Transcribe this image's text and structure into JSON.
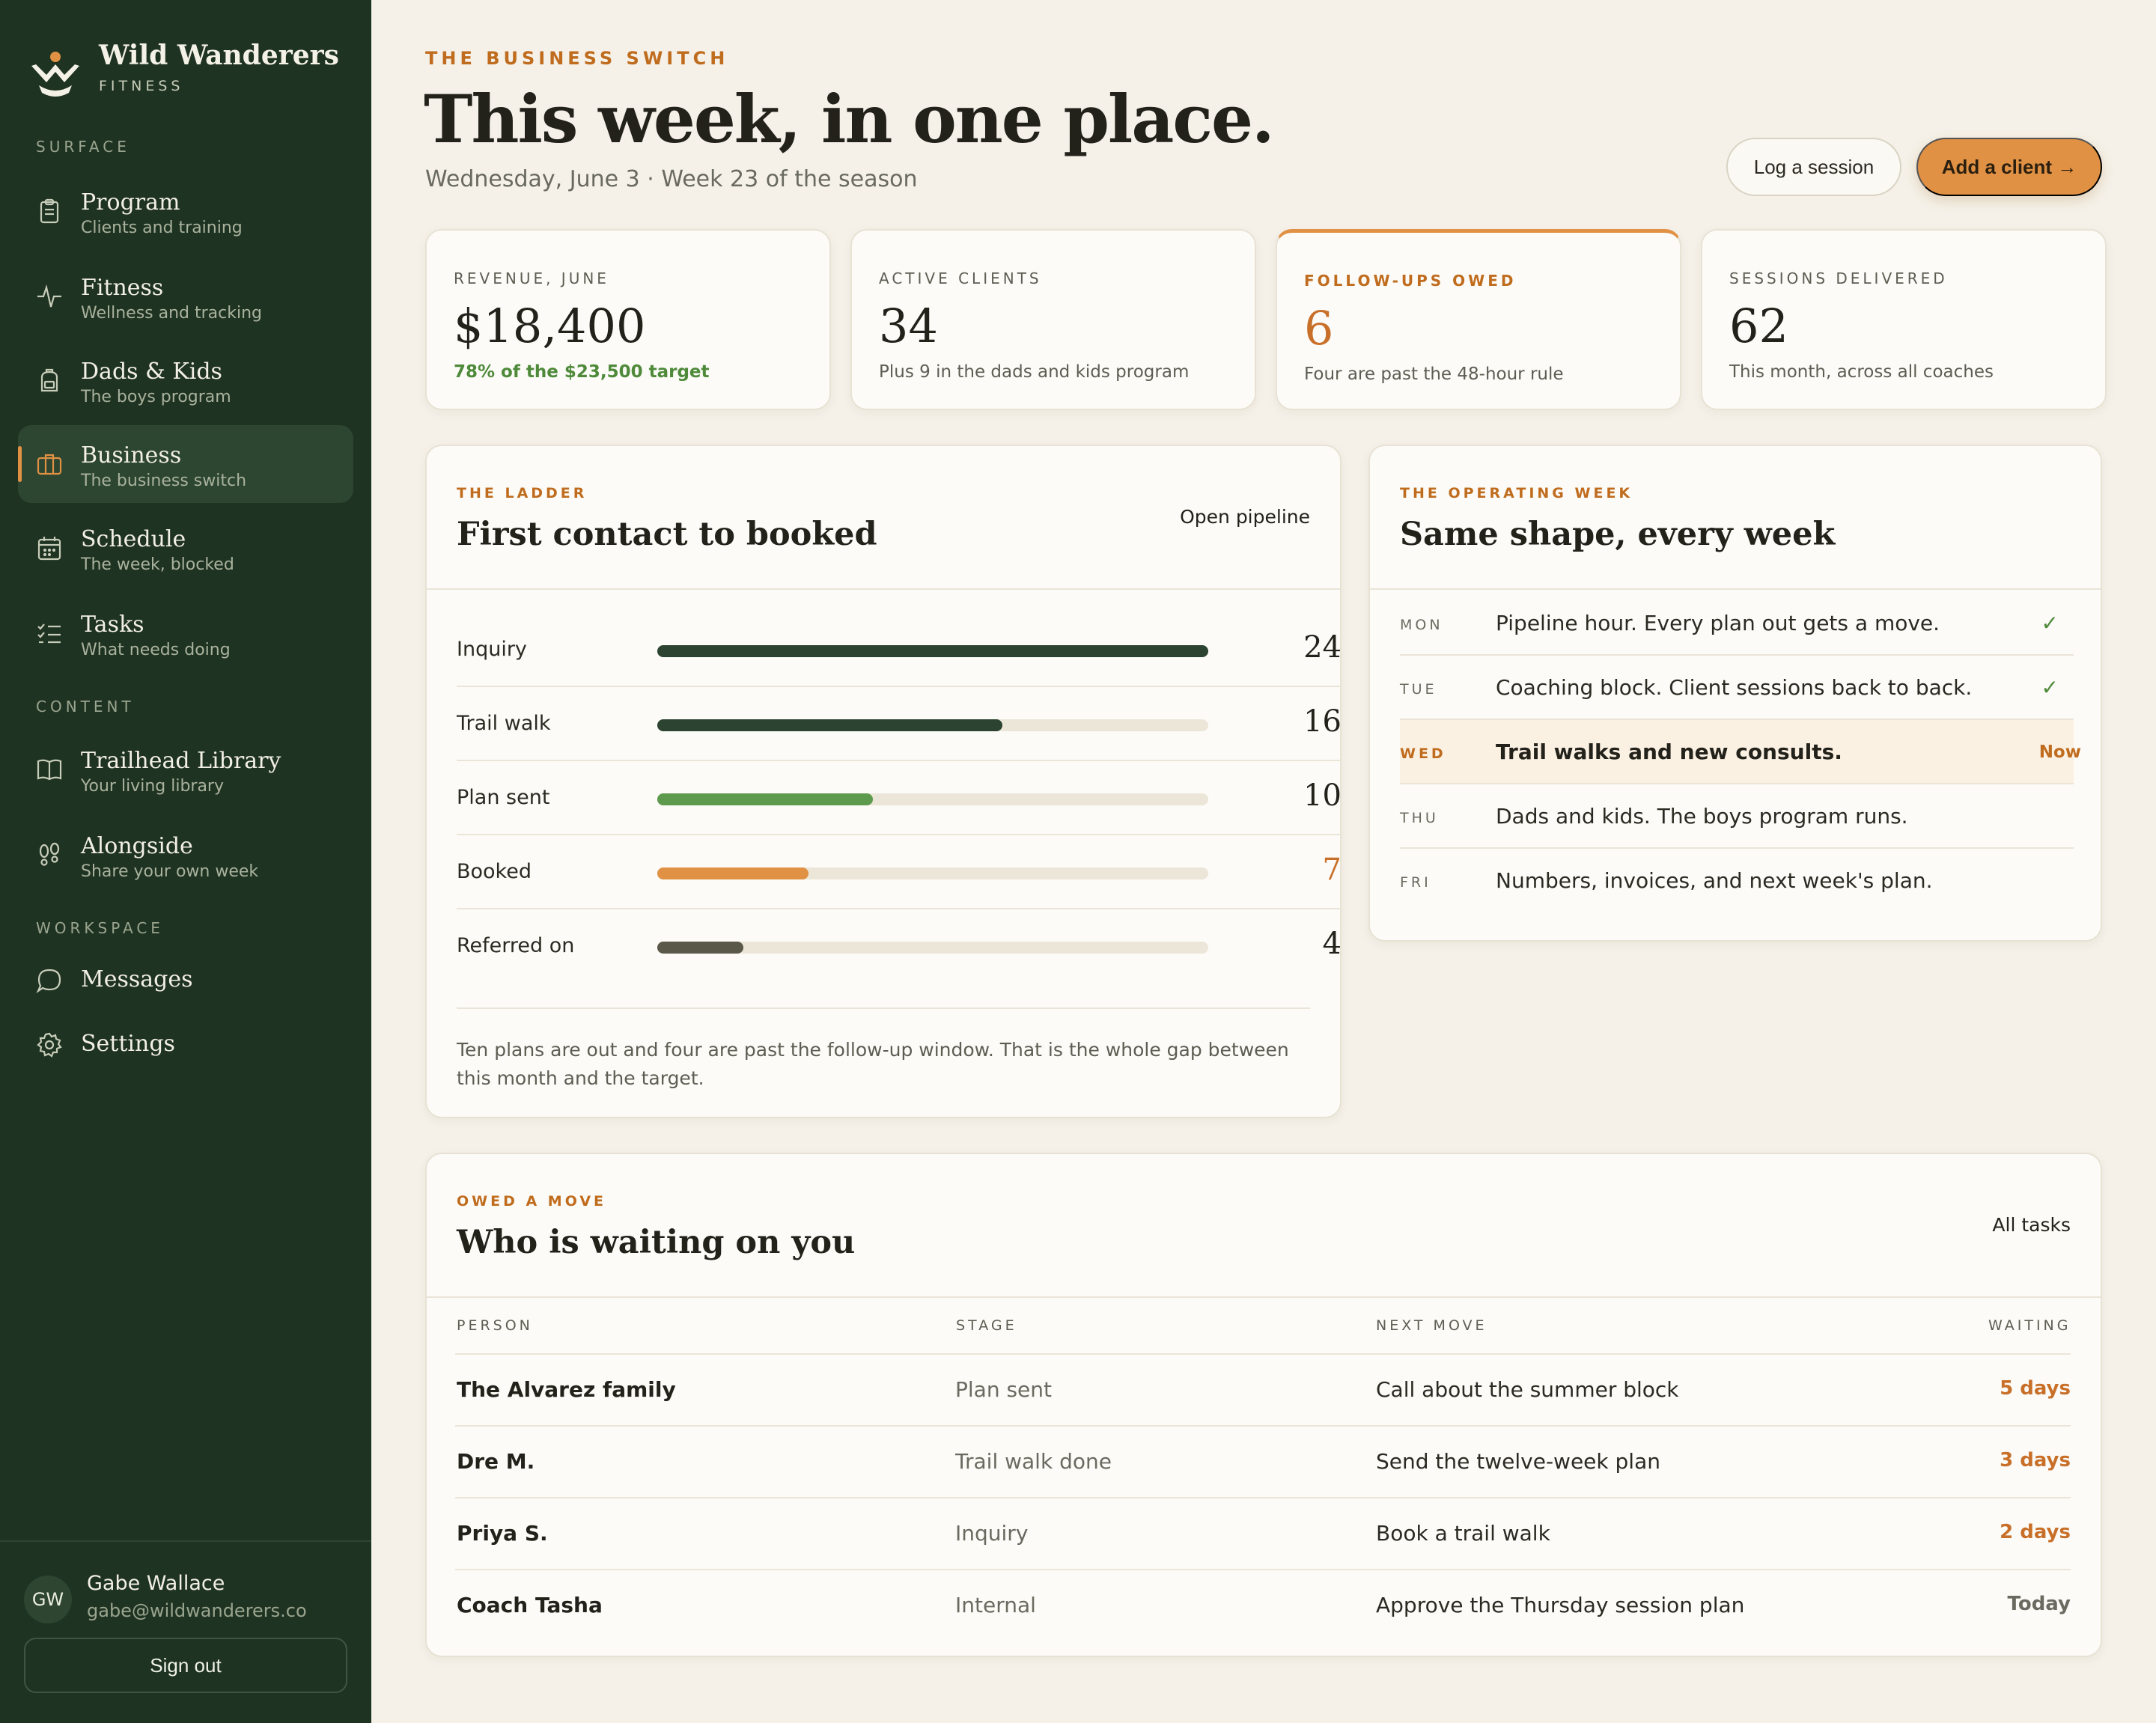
{
  "brand": {
    "name": "Wild Wanderers",
    "subtitle": "FITNESS"
  },
  "sidebar": {
    "sections": {
      "surface": "SURFACE",
      "content": "CONTENT",
      "workspace": "WORKSPACE"
    },
    "items": [
      {
        "title": "Program",
        "subtitle": "Clients and training",
        "icon": "clipboard-icon"
      },
      {
        "title": "Fitness",
        "subtitle": "Wellness and tracking",
        "icon": "pulse-icon"
      },
      {
        "title": "Dads & Kids",
        "subtitle": "The boys program",
        "icon": "backpack-icon"
      },
      {
        "title": "Business",
        "subtitle": "The business switch",
        "icon": "briefcase-icon",
        "active": true
      },
      {
        "title": "Schedule",
        "subtitle": "The week, blocked",
        "icon": "calendar-icon"
      },
      {
        "title": "Tasks",
        "subtitle": "What needs doing",
        "icon": "checklist-icon"
      },
      {
        "title": "Trailhead Library",
        "subtitle": "Your living library",
        "icon": "book-icon"
      },
      {
        "title": "Alongside",
        "subtitle": "Share your own week",
        "icon": "footprints-icon"
      },
      {
        "title": "Messages",
        "icon": "chat-bubble-icon"
      },
      {
        "title": "Settings",
        "icon": "gear-icon"
      }
    ],
    "user": {
      "initials": "GW",
      "name": "Gabe Wallace",
      "email": "gabe@wildwanderers.co"
    },
    "signout_label": "Sign out"
  },
  "header": {
    "eyebrow": "THE BUSINESS SWITCH",
    "title": "This week, in one place.",
    "subtitle": "Wednesday, June 3 · Week 23 of the season",
    "log_session_label": "Log a session",
    "add_client_label": "Add a client →"
  },
  "stats": [
    {
      "label": "REVENUE, JUNE",
      "value": "$18,400",
      "note": "78% of the $23,500 target"
    },
    {
      "label": "ACTIVE CLIENTS",
      "value": "34",
      "note": "Plus 9 in the dads and kids program"
    },
    {
      "label": "FOLLOW-UPS OWED",
      "value": "6",
      "note": "Four are past the 48-hour rule"
    },
    {
      "label": "SESSIONS DELIVERED",
      "value": "62",
      "note": "This month, across all coaches"
    }
  ],
  "ladder": {
    "eyebrow": "THE LADDER",
    "title": "First contact to booked",
    "link": "Open pipeline",
    "max": 24,
    "rows": [
      {
        "label": "Inquiry",
        "value": 24,
        "display": "24",
        "color": "#2b4330"
      },
      {
        "label": "Trail walk",
        "value": 16,
        "display": "16",
        "color": "#2b4330"
      },
      {
        "label": "Plan sent",
        "value": 10,
        "display": "10",
        "color": "#5e9a4e"
      },
      {
        "label": "Booked",
        "value": 7,
        "display": "7",
        "color": "#e09144"
      },
      {
        "label": "Referred on",
        "value": 4,
        "display": "4",
        "color": "#5a5848"
      }
    ],
    "footnote": "Ten plans are out and four are past the follow-up window. That is the whole gap between this month and the target."
  },
  "week": {
    "eyebrow": "THE OPERATING WEEK",
    "title": "Same shape, every week",
    "rows": [
      {
        "day": "MON",
        "text": "Pipeline hour. Every plan out gets a move.",
        "status": "✓"
      },
      {
        "day": "TUE",
        "text": "Coaching block. Client sessions back to back.",
        "status": "✓"
      },
      {
        "day": "WED",
        "text": "Trail walks and new consults.",
        "status": "Now"
      },
      {
        "day": "THU",
        "text": "Dads and kids. The boys program runs.",
        "status": ""
      },
      {
        "day": "FRI",
        "text": "Numbers, invoices, and next week's plan.",
        "status": ""
      }
    ]
  },
  "waiting": {
    "eyebrow": "OWED A MOVE",
    "title": "Who is waiting on you",
    "link": "All tasks",
    "columns": [
      "PERSON",
      "STAGE",
      "NEXT MOVE",
      "WAITING"
    ],
    "rows": [
      {
        "person": "The Alvarez family",
        "stage": "Plan sent",
        "next": "Call about the summer block",
        "waiting": "5 days"
      },
      {
        "person": "Dre M.",
        "stage": "Trail walk done",
        "next": "Send the twelve-week plan",
        "waiting": "3 days"
      },
      {
        "person": "Priya S.",
        "stage": "Inquiry",
        "next": "Book a trail walk",
        "waiting": "2 days"
      },
      {
        "person": "Coach Tasha",
        "stage": "Internal",
        "next": "Approve the Thursday session plan",
        "waiting": "Today"
      }
    ]
  }
}
